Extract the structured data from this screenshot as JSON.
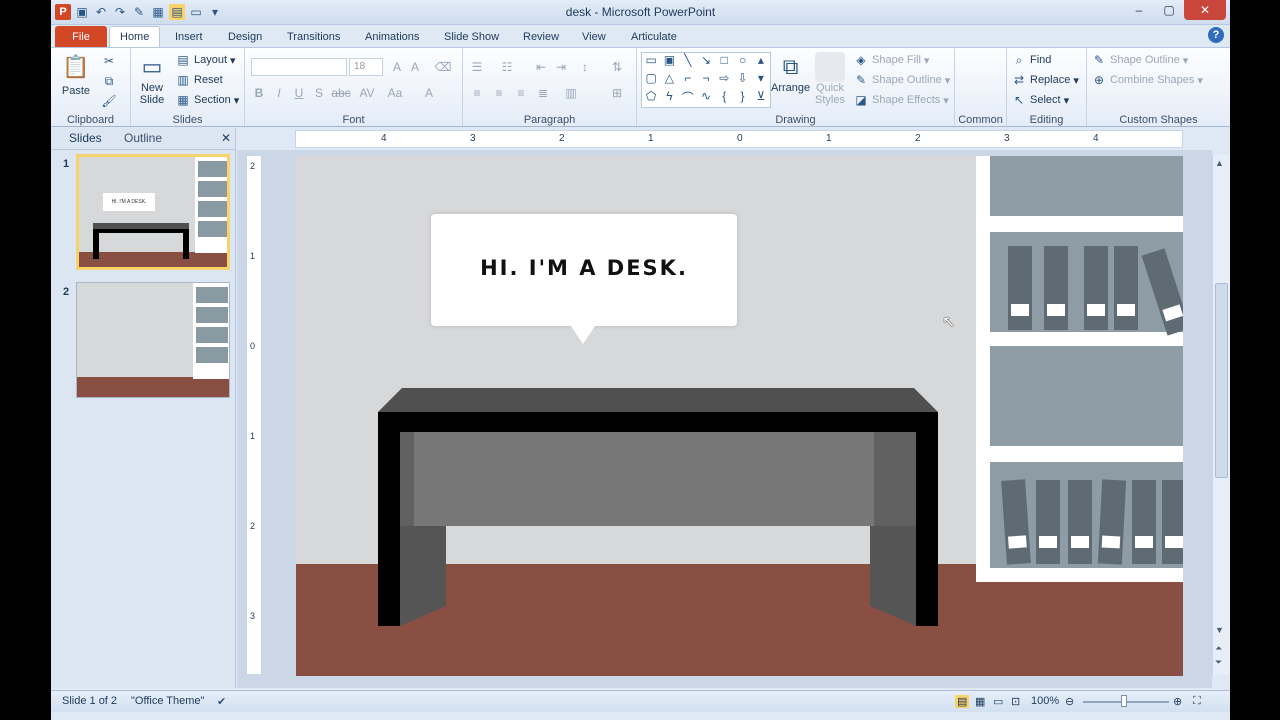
{
  "window": {
    "title": "desk - Microsoft PowerPoint"
  },
  "tabs": [
    "File",
    "Home",
    "Insert",
    "Design",
    "Transitions",
    "Animations",
    "Slide Show",
    "Review",
    "View",
    "Articulate"
  ],
  "ribbon": {
    "clipboard": {
      "label": "Clipboard",
      "paste": "Paste"
    },
    "slides": {
      "label": "Slides",
      "new_slide_1": "New",
      "new_slide_2": "Slide",
      "layout": "Layout",
      "reset": "Reset",
      "section": "Section"
    },
    "font": {
      "label": "Font",
      "size": "18"
    },
    "paragraph": {
      "label": "Paragraph"
    },
    "drawing": {
      "label": "Drawing",
      "arrange": "Arrange",
      "quick_styles_1": "Quick",
      "quick_styles_2": "Styles",
      "shape_fill": "Shape Fill",
      "shape_outline": "Shape Outline",
      "shape_effects": "Shape Effects"
    },
    "common": {
      "label": "Common"
    },
    "editing": {
      "label": "Editing",
      "find": "Find",
      "replace": "Replace",
      "select": "Select"
    },
    "custom_shapes": {
      "label": "Custom Shapes",
      "shape_outline": "Shape Outline",
      "combine_shapes": "Combine Shapes"
    }
  },
  "panel": {
    "tab_slides": "Slides",
    "tab_outline": "Outline",
    "slide_numbers": [
      "1",
      "2"
    ],
    "thumb_text": "HI. I'M A DESK."
  },
  "ruler": {
    "h_labels": [
      "4",
      "3",
      "2",
      "1",
      "0",
      "1",
      "2",
      "3",
      "4"
    ],
    "v_labels": [
      "2",
      "1",
      "0",
      "1",
      "2",
      "3"
    ]
  },
  "slide": {
    "speech_text": "HI. I'M A DESK."
  },
  "status": {
    "slide_info": "Slide 1 of 2",
    "theme": "\"Office Theme\"",
    "zoom": "100%"
  },
  "colors": {
    "floor": "#8a4f43",
    "wall": "#d7d8d9",
    "desk_top": "#505050",
    "desk_black": "#000000",
    "accent": "#d24726"
  }
}
